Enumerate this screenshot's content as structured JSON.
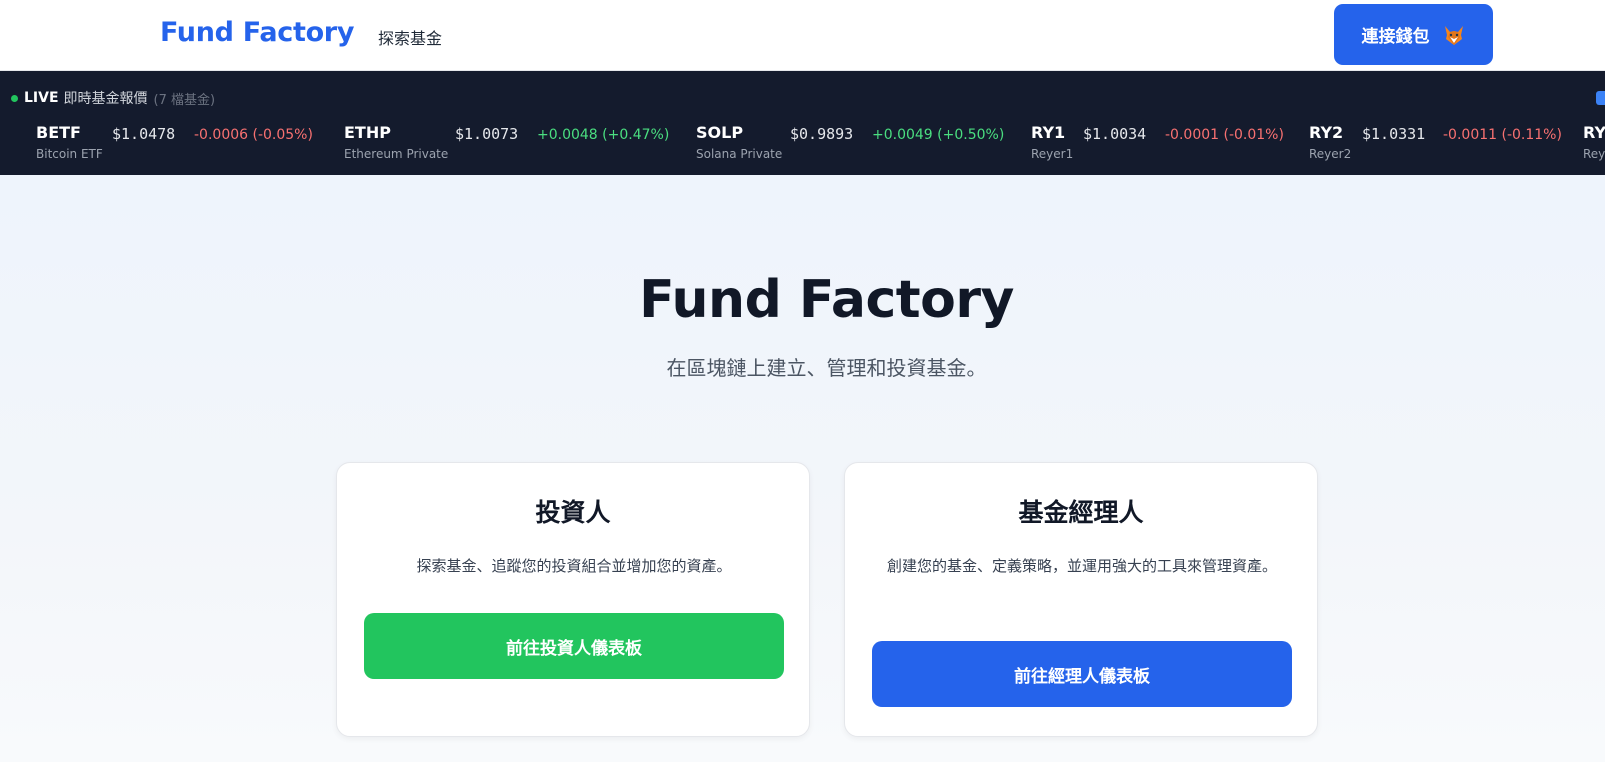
{
  "navbar": {
    "brand": "Fund Factory",
    "explore_link": "探索基金",
    "connect_button": "連接錢包",
    "connect_icon": "fox-icon"
  },
  "ticker": {
    "live_label": "LIVE",
    "title": "即時基金報價",
    "fund_count": "(7 檔基金)",
    "quotes": [
      {
        "symbol": "BETF",
        "name": "Bitcoin ETF",
        "price": "$1.0478",
        "change": "-0.0006 (-0.05%)",
        "direction": "down"
      },
      {
        "symbol": "ETHP",
        "name": "Ethereum Private",
        "price": "$1.0073",
        "change": "+0.0048 (+0.47%)",
        "direction": "up"
      },
      {
        "symbol": "SOLP",
        "name": "Solana Private",
        "price": "$0.9893",
        "change": "+0.0049 (+0.50%)",
        "direction": "up"
      },
      {
        "symbol": "RY1",
        "name": "Reyer1",
        "price": "$1.0034",
        "change": "-0.0001 (-0.01%)",
        "direction": "down"
      },
      {
        "symbol": "RY2",
        "name": "Reyer2",
        "price": "$1.0331",
        "change": "-0.0011 (-0.11%)",
        "direction": "down"
      },
      {
        "symbol": "RY",
        "name": "Rey",
        "price": "",
        "change": "",
        "direction": ""
      }
    ],
    "colors": {
      "up": "#4ade80",
      "down": "#f87171",
      "live_dot": "#22c55e"
    }
  },
  "hero": {
    "title": "Fund Factory",
    "subtitle": "在區塊鏈上建立、管理和投資基金。"
  },
  "cards": {
    "investor": {
      "title": "投資人",
      "description": "探索基金、追蹤您的投資組合並增加您的資產。",
      "button": "前往投資人儀表板"
    },
    "manager": {
      "title": "基金經理人",
      "description": "創建您的基金、定義策略，並運用強大的工具來管理資產。",
      "button": "前往經理人儀表板"
    }
  },
  "colors": {
    "brand": "#2563eb",
    "green": "#22c55e",
    "ticker_bg": "#141b2d"
  }
}
